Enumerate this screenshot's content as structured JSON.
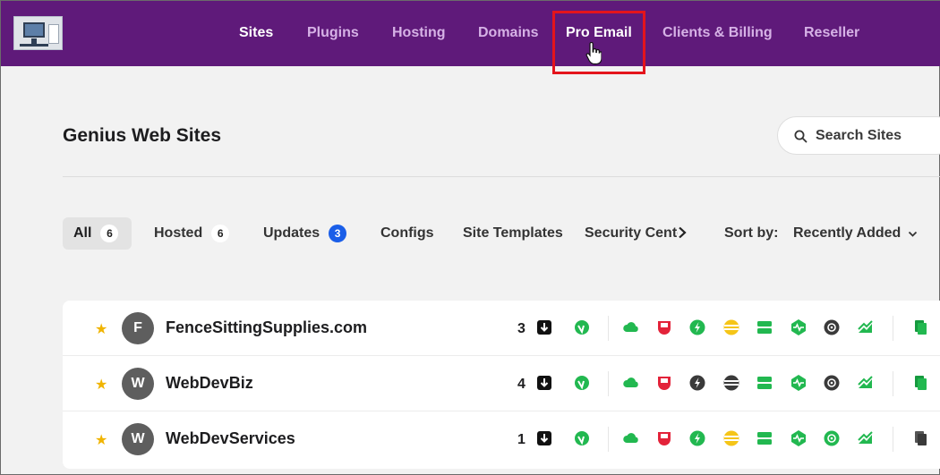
{
  "nav": {
    "items": [
      {
        "label": "Sites",
        "active": true
      },
      {
        "label": "Plugins",
        "active": false
      },
      {
        "label": "Hosting",
        "active": false
      },
      {
        "label": "Domains",
        "active": false
      },
      {
        "label": "Pro Email",
        "active": true
      },
      {
        "label": "Clients & Billing",
        "active": false
      },
      {
        "label": "Reseller",
        "active": false
      }
    ]
  },
  "header": {
    "title": "Genius Web Sites",
    "search_placeholder": "Search Sites"
  },
  "filters": {
    "tabs": [
      {
        "label": "All",
        "count": "6"
      },
      {
        "label": "Hosted",
        "count": "6"
      },
      {
        "label": "Updates",
        "count": "3"
      },
      {
        "label": "Configs"
      },
      {
        "label": "Site Templates"
      },
      {
        "label": "Security Cente"
      }
    ],
    "sort_label": "Sort by:",
    "sort_value": "Recently Added"
  },
  "sites": [
    {
      "initial": "F",
      "name": "FenceSittingSupplies.com",
      "updates": "3"
    },
    {
      "initial": "W",
      "name": "WebDevBiz",
      "updates": "4"
    },
    {
      "initial": "W",
      "name": "WebDevServices",
      "updates": "1"
    }
  ],
  "status_icons": [
    "download-icon",
    "wordfence-icon",
    "cloud-icon",
    "backup-icon",
    "performance-icon",
    "cache-icon",
    "hosting-icon",
    "uptime-icon",
    "security-scan-icon",
    "analytics-icon",
    "clone-icon"
  ],
  "colors": {
    "nav_bg": "#5f1a7a",
    "nav_text": "#d6b2e6",
    "highlight": "#e4141c",
    "green": "#22b850",
    "red": "#e3233a",
    "yellow": "#f5c518",
    "blue_badge": "#1a5ee8",
    "dark_icon": "#3a3a3a"
  }
}
